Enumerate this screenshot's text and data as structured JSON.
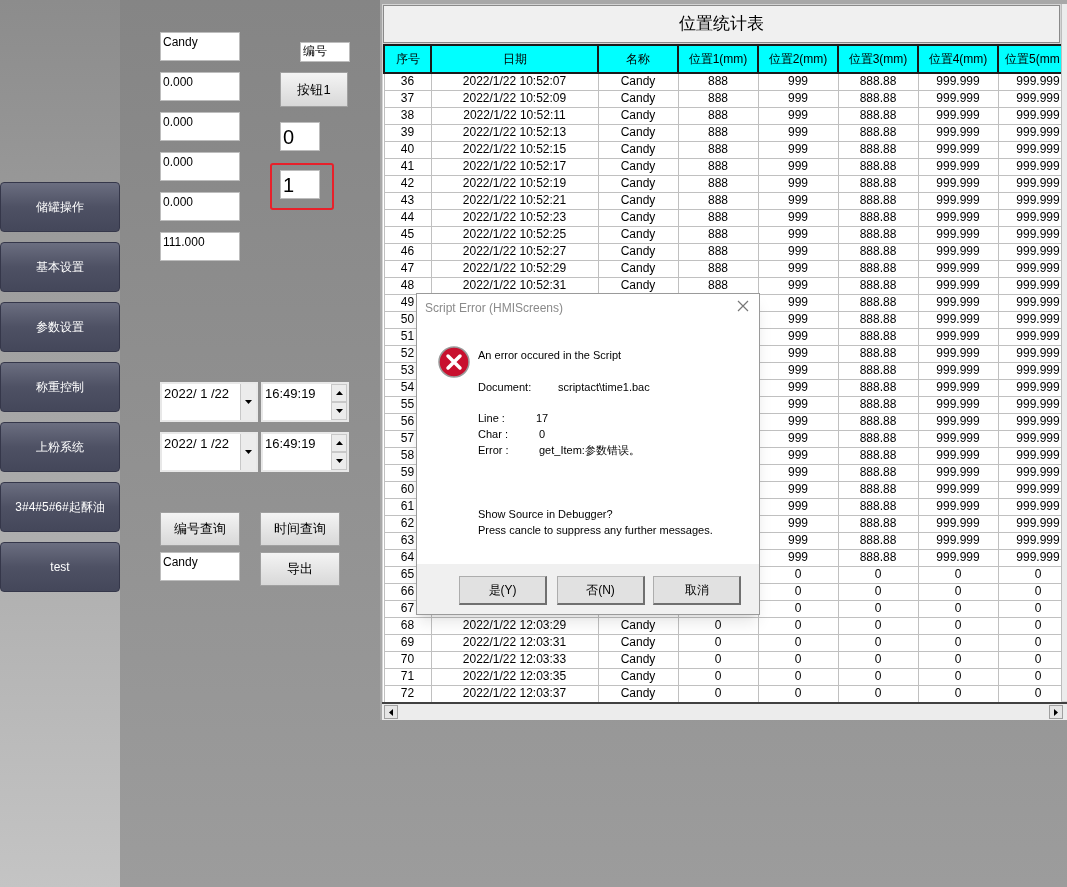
{
  "sidebar": {
    "buttons": [
      "储罐操作",
      "基本设置",
      "参数设置",
      "称重控制",
      "上粉系统",
      "3#4#5#6#起酥油",
      "test"
    ]
  },
  "fields": [
    {
      "value": "Candy"
    },
    {
      "value": "0.000"
    },
    {
      "value": "0.000"
    },
    {
      "value": "0.000"
    },
    {
      "value": "0.000"
    },
    {
      "value": "111.000"
    }
  ],
  "id_field": {
    "value": "编号"
  },
  "button_1": "按钮1",
  "value_boxes": [
    {
      "value": "0",
      "highlighted": false
    },
    {
      "value": "1",
      "highlighted": true
    }
  ],
  "date_ranges": [
    {
      "date": "2022/ 1 /22",
      "time": "16:49:19"
    },
    {
      "date": "2022/ 1 /22",
      "time": "16:49:19"
    }
  ],
  "query_buttons": [
    "编号查询",
    "时间查询"
  ],
  "name_field": {
    "value": "Candy"
  },
  "export_button": "导出",
  "table": {
    "title": "位置统计表",
    "columns": [
      "序号",
      "日期",
      "名称",
      "位置1(mm)",
      "位置2(mm)",
      "位置3(mm)",
      "位置4(mm)",
      "位置5(mm"
    ],
    "rows": [
      {
        "kind": "full",
        "cells": [
          "36",
          "2022/1/22 10:52:07",
          "Candy",
          "888",
          "999",
          "888.88",
          "999.999",
          "999.999"
        ]
      },
      {
        "kind": "full",
        "cells": [
          "37",
          "2022/1/22 10:52:09",
          "Candy",
          "888",
          "999",
          "888.88",
          "999.999",
          "999.999"
        ]
      },
      {
        "kind": "full",
        "cells": [
          "38",
          "2022/1/22 10:52:11",
          "Candy",
          "888",
          "999",
          "888.88",
          "999.999",
          "999.999"
        ]
      },
      {
        "kind": "full",
        "cells": [
          "39",
          "2022/1/22 10:52:13",
          "Candy",
          "888",
          "999",
          "888.88",
          "999.999",
          "999.999"
        ]
      },
      {
        "kind": "full",
        "cells": [
          "40",
          "2022/1/22 10:52:15",
          "Candy",
          "888",
          "999",
          "888.88",
          "999.999",
          "999.999"
        ]
      },
      {
        "kind": "full",
        "cells": [
          "41",
          "2022/1/22 10:52:17",
          "Candy",
          "888",
          "999",
          "888.88",
          "999.999",
          "999.999"
        ]
      },
      {
        "kind": "full",
        "cells": [
          "42",
          "2022/1/22 10:52:19",
          "Candy",
          "888",
          "999",
          "888.88",
          "999.999",
          "999.999"
        ]
      },
      {
        "kind": "full",
        "cells": [
          "43",
          "2022/1/22 10:52:21",
          "Candy",
          "888",
          "999",
          "888.88",
          "999.999",
          "999.999"
        ]
      },
      {
        "kind": "full",
        "cells": [
          "44",
          "2022/1/22 10:52:23",
          "Candy",
          "888",
          "999",
          "888.88",
          "999.999",
          "999.999"
        ]
      },
      {
        "kind": "full",
        "cells": [
          "45",
          "2022/1/22 10:52:25",
          "Candy",
          "888",
          "999",
          "888.88",
          "999.999",
          "999.999"
        ]
      },
      {
        "kind": "full",
        "cells": [
          "46",
          "2022/1/22 10:52:27",
          "Candy",
          "888",
          "999",
          "888.88",
          "999.999",
          "999.999"
        ]
      },
      {
        "kind": "full",
        "cells": [
          "47",
          "2022/1/22 10:52:29",
          "Candy",
          "888",
          "999",
          "888.88",
          "999.999",
          "999.999"
        ]
      },
      {
        "kind": "full",
        "cells": [
          "48",
          "2022/1/22 10:52:31",
          "Candy",
          "888",
          "999",
          "888.88",
          "999.999",
          "999.999"
        ]
      },
      {
        "kind": "covered",
        "cells": [
          "49",
          "999",
          "888.88",
          "999.999",
          "999.999"
        ]
      },
      {
        "kind": "covered",
        "cells": [
          "50",
          "999",
          "888.88",
          "999.999",
          "999.999"
        ]
      },
      {
        "kind": "covered",
        "cells": [
          "51",
          "999",
          "888.88",
          "999.999",
          "999.999"
        ]
      },
      {
        "kind": "covered",
        "cells": [
          "52",
          "999",
          "888.88",
          "999.999",
          "999.999"
        ]
      },
      {
        "kind": "covered",
        "cells": [
          "53",
          "999",
          "888.88",
          "999.999",
          "999.999"
        ]
      },
      {
        "kind": "covered",
        "cells": [
          "54",
          "999",
          "888.88",
          "999.999",
          "999.999"
        ]
      },
      {
        "kind": "covered",
        "cells": [
          "55",
          "999",
          "888.88",
          "999.999",
          "999.999"
        ]
      },
      {
        "kind": "covered",
        "cells": [
          "56",
          "999",
          "888.88",
          "999.999",
          "999.999"
        ]
      },
      {
        "kind": "covered",
        "cells": [
          "57",
          "999",
          "888.88",
          "999.999",
          "999.999"
        ]
      },
      {
        "kind": "covered",
        "cells": [
          "58",
          "999",
          "888.88",
          "999.999",
          "999.999"
        ]
      },
      {
        "kind": "covered",
        "cells": [
          "59",
          "999",
          "888.88",
          "999.999",
          "999.999"
        ]
      },
      {
        "kind": "covered",
        "cells": [
          "60",
          "999",
          "888.88",
          "999.999",
          "999.999"
        ]
      },
      {
        "kind": "covered",
        "cells": [
          "61",
          "999",
          "888.88",
          "999.999",
          "999.999"
        ]
      },
      {
        "kind": "covered",
        "cells": [
          "62",
          "999",
          "888.88",
          "999.999",
          "999.999"
        ]
      },
      {
        "kind": "covered",
        "cells": [
          "63",
          "999",
          "888.88",
          "999.999",
          "999.999"
        ]
      },
      {
        "kind": "covered",
        "cells": [
          "64",
          "999",
          "888.88",
          "999.999",
          "999.999"
        ]
      },
      {
        "kind": "covered",
        "cells": [
          "65",
          "0",
          "0",
          "0",
          "0"
        ]
      },
      {
        "kind": "covered",
        "cells": [
          "66",
          "0",
          "0",
          "0",
          "0"
        ]
      },
      {
        "kind": "covered",
        "cells": [
          "67",
          "0",
          "0",
          "0",
          "0"
        ]
      },
      {
        "kind": "full",
        "cells": [
          "68",
          "2022/1/22 12:03:29",
          "Candy",
          "0",
          "0",
          "0",
          "0",
          "0"
        ]
      },
      {
        "kind": "full",
        "cells": [
          "69",
          "2022/1/22 12:03:31",
          "Candy",
          "0",
          "0",
          "0",
          "0",
          "0"
        ]
      },
      {
        "kind": "full",
        "cells": [
          "70",
          "2022/1/22 12:03:33",
          "Candy",
          "0",
          "0",
          "0",
          "0",
          "0"
        ]
      },
      {
        "kind": "full",
        "cells": [
          "71",
          "2022/1/22 12:03:35",
          "Candy",
          "0",
          "0",
          "0",
          "0",
          "0"
        ]
      },
      {
        "kind": "full",
        "cells": [
          "72",
          "2022/1/22 12:03:37",
          "Candy",
          "0",
          "0",
          "0",
          "0",
          "0"
        ]
      }
    ]
  },
  "dialog": {
    "title": "Script Error (HMIScreens)",
    "heading": "An error occured in the Script",
    "details": [
      {
        "label": "Document:",
        "value": "scriptact\\time1.bac"
      },
      {
        "label": "Line :",
        "value": "17"
      },
      {
        "label": "Char :",
        "value": "0"
      },
      {
        "label": "Error :",
        "value": "get_Item:参数错误。"
      }
    ],
    "prompt": [
      "Show Source in Debugger?",
      "Press cancle to suppress any further messages."
    ],
    "buttons": [
      "是(Y)",
      "否(N)",
      "取消"
    ]
  }
}
